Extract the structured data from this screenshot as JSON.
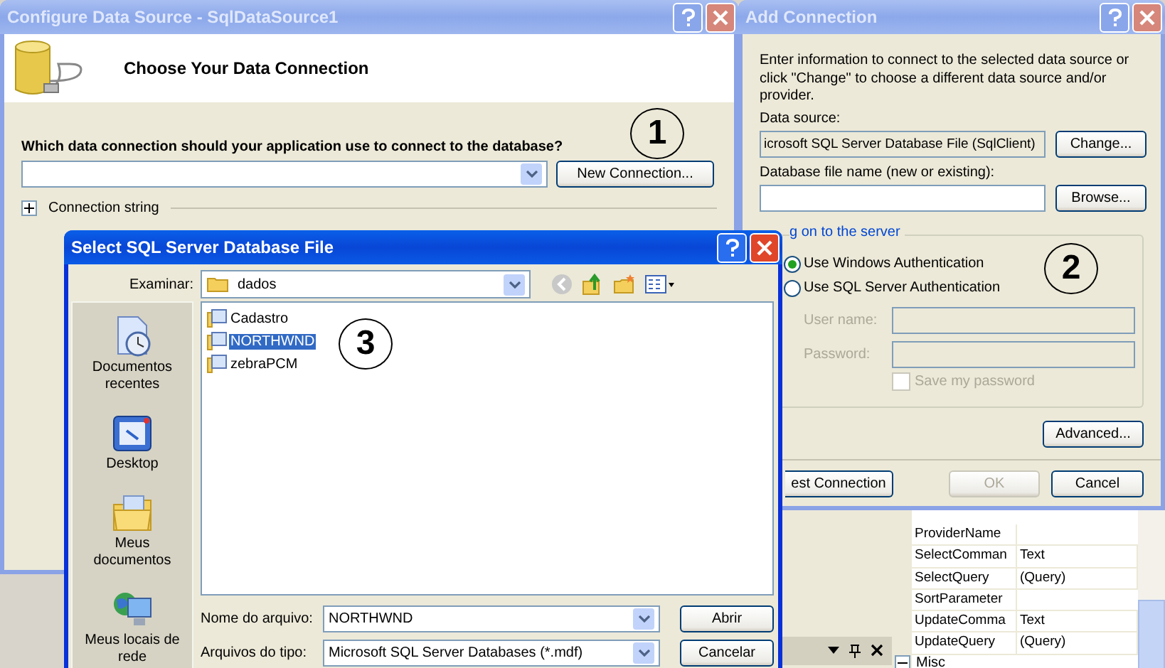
{
  "configure_dialog": {
    "title": "Configure Data Source - SqlDataSource1",
    "active": false,
    "heading": "Choose Your Data Connection",
    "question": "Which data connection should your application use to connect to the database?",
    "new_connection_button": "New Connection...",
    "connection_string": {
      "label": "Connection string",
      "expanded": false
    },
    "callout": "1"
  },
  "add_connection": {
    "title": "Add Connection",
    "active": false,
    "description": "Enter information to connect to the selected data source or click \"Change\" to choose a different data source and/or provider.",
    "data_source_label": "Data source:",
    "data_source_value": "icrosoft SQL Server Database File (SqlClient)",
    "change_button": "Change...",
    "file_name_label": "Database file name (new or existing):",
    "browse_button": "Browse...",
    "group_label": "g on to the server",
    "auth_options": [
      {
        "label": "Use Windows Authentication",
        "selected": true
      },
      {
        "label": "Use SQL Server Authentication",
        "selected": false
      }
    ],
    "login_disabled": true,
    "user_name_label": "User name:",
    "password_label": "Password:",
    "save_password": {
      "label": "Save my password",
      "checked": false
    },
    "advanced_button": "Advanced...",
    "test_button": "est Connection",
    "ok_button": {
      "label": "OK",
      "disabled": true
    },
    "cancel_button": "Cancel",
    "callout": "2"
  },
  "file_dialog": {
    "title": "Select SQL Server Database File",
    "active": true,
    "look_in_label": "Examinar:",
    "look_in_value": "dados",
    "places": [
      {
        "kind": "recent",
        "label": "Documentos recentes"
      },
      {
        "kind": "desktop",
        "label": "Desktop"
      },
      {
        "kind": "documents",
        "label": "Meus documentos"
      },
      {
        "kind": "network",
        "label": "Meus locais de rede"
      }
    ],
    "files": [
      {
        "name": "Cadastro",
        "selected": false
      },
      {
        "name": "NORTHWND",
        "selected": true
      },
      {
        "name": "zebraPCM",
        "selected": false
      }
    ],
    "file_name_label": "Nome do arquivo:",
    "file_name_value": "NORTHWND",
    "file_type_label": "Arquivos do tipo:",
    "file_type_value": "Microsoft SQL Server Databases (*.mdf)",
    "open_button": "Abrir",
    "cancel_button": "Cancelar",
    "callout": "3"
  },
  "properties": {
    "rows": [
      {
        "name": "ProviderName",
        "value": ""
      },
      {
        "name": "SelectComman",
        "value": "Text"
      },
      {
        "name": "SelectQuery",
        "value": "(Query)"
      },
      {
        "name": "SortParameter",
        "value": ""
      },
      {
        "name": "UpdateComma",
        "value": "Text"
      },
      {
        "name": "UpdateQuery",
        "value": "(Query)"
      }
    ],
    "section": {
      "label": "Misc",
      "expanded": true
    }
  }
}
